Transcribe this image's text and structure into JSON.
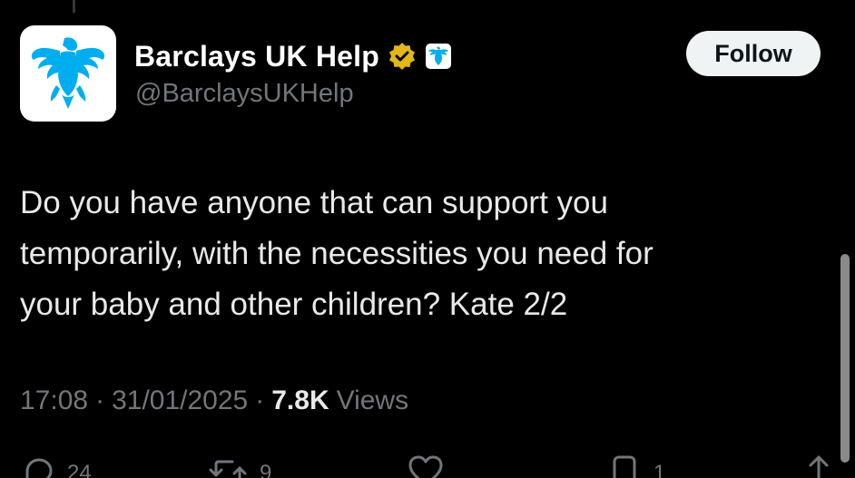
{
  "tweet": {
    "display_name": "Barclays UK Help",
    "handle": "@BarclaysUKHelp",
    "follow_label": "Follow",
    "text_lines": [
      "Do you have anyone that can support you",
      "temporarily, with the necessities you need for",
      "your baby and other children? Kate 2/2"
    ],
    "time": "17:08",
    "date": "31/01/2025",
    "separator": "·",
    "views_count": "7.8K",
    "views_label": "Views"
  },
  "actions": {
    "replies": "24",
    "reposts": "9",
    "bookmarks": "1"
  },
  "icons": {
    "avatar": "barclays-eagle-logo",
    "verified": "gold-verified-badge",
    "affiliate": "barclays-affiliate-badge",
    "reply": "reply-icon",
    "repost": "repost-icon",
    "like": "like-icon",
    "bookmark": "bookmark-icon",
    "share": "share-icon"
  },
  "colors": {
    "background": "#000000",
    "text": "#e7e9ea",
    "secondary": "#71767b",
    "brand_blue": "#00aeef",
    "gold_badge": "#e2b719",
    "follow_bg": "#eff3f4"
  }
}
